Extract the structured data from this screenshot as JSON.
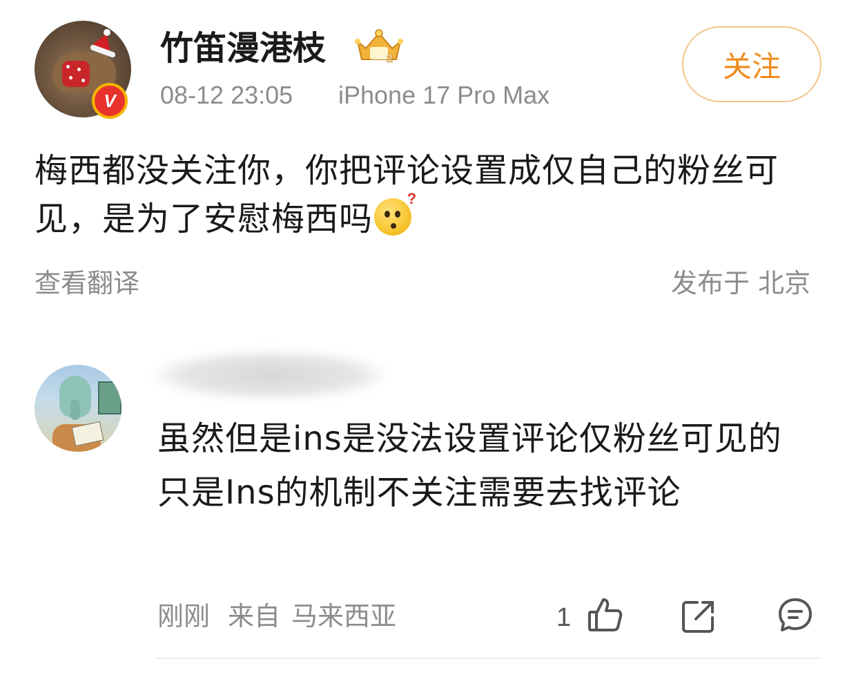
{
  "post": {
    "username": "竹笛漫港枝",
    "timestamp": "08-12 23:05",
    "device": "iPhone 17 Pro Max",
    "follow_label": "关注",
    "text": "梅西都没关注你，你把评论设置成仅自己的粉丝可见，是为了安慰梅西吗",
    "translate_label": "查看翻译",
    "location": "发布于 北京",
    "avatar_badge": "V",
    "crown_level": "2",
    "emoji_q": "?"
  },
  "comment": {
    "text": "虽然但是ins是没法设置评论仅粉丝可见的 只是Ins的机制不关注需要去找评论",
    "time": "刚刚",
    "location_prefix": "来自",
    "location": "马来西亚",
    "like_count": "1"
  },
  "icons": [
    "verified-v-icon",
    "crown-level-icon",
    "puzzled-emoji-icon",
    "thumbs-up-icon",
    "share-icon",
    "reply-bubble-icon"
  ],
  "colors": {
    "follow_text": "#f08a1a",
    "follow_border": "#f2c58a",
    "meta_gray": "#8c8c8c",
    "verified_red": "#e8332d",
    "verified_ring": "#f5b400"
  }
}
